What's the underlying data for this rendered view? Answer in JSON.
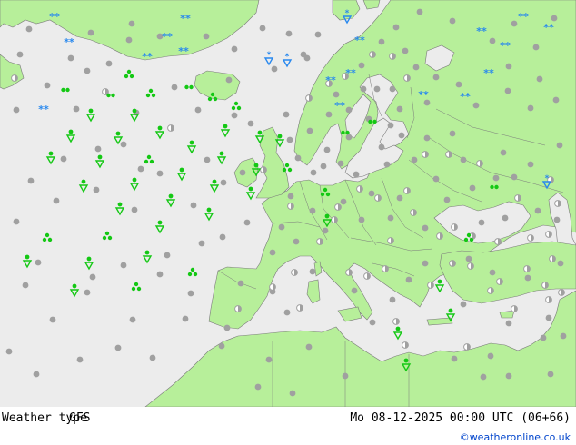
{
  "footer": {
    "title": "Weather type",
    "model": "GFS",
    "datetime": "Mo 08-12-2025 00:00 UTC (06+66)",
    "credit": "©weatheronline.co.uk"
  },
  "colors": {
    "sea": "#ececec",
    "land": "#b7ef9a",
    "border": "#7a7a7a",
    "dot": "#a0a0a0",
    "shower": "#14c814",
    "snow": "#2888ee"
  },
  "legend_symbols": [
    "cloudy-dot",
    "rain-shower",
    "thunder-shower",
    "drizzle",
    "snow",
    "snow-shower",
    "partly-cloudy"
  ]
}
